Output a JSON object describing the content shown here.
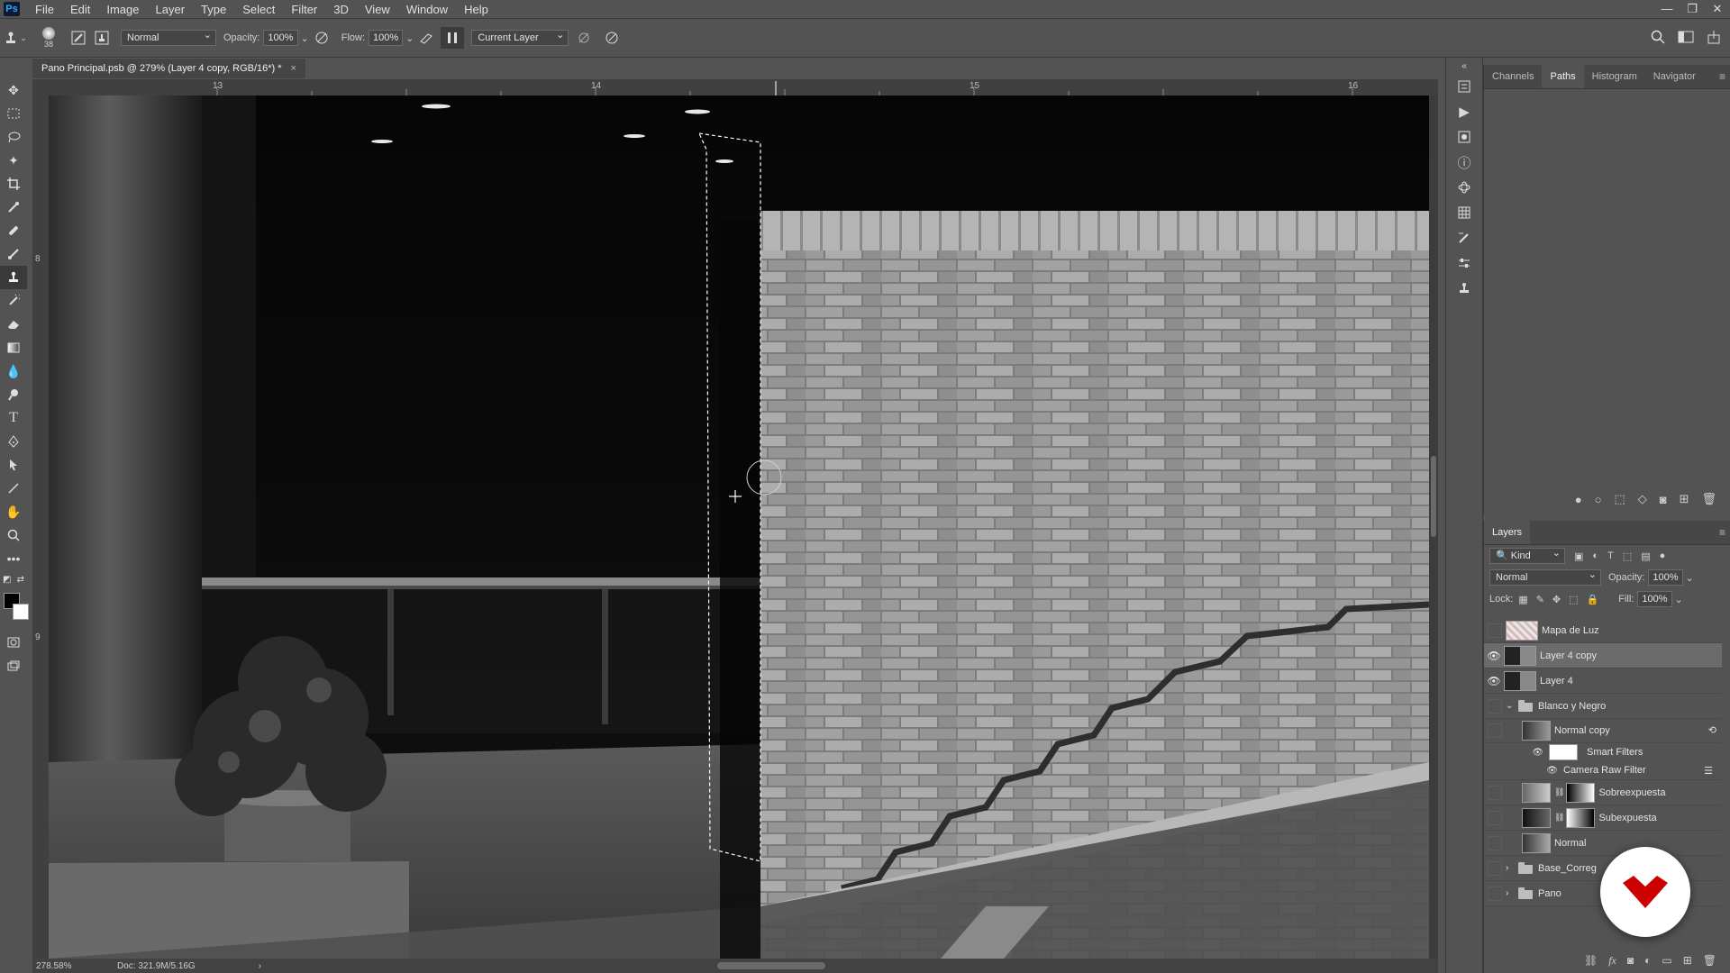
{
  "menu": [
    "File",
    "Edit",
    "Image",
    "Layer",
    "Type",
    "Select",
    "Filter",
    "3D",
    "View",
    "Window",
    "Help"
  ],
  "app_logo": "Ps",
  "window_controls": [
    "—",
    "❐",
    "✕"
  ],
  "options": {
    "brush_size": "38",
    "mode": "Normal",
    "opacity_label": "Opacity:",
    "opacity_value": "100%",
    "flow_label": "Flow:",
    "flow_value": "100%",
    "sample": "Current Layer"
  },
  "document": {
    "tab_title": "Pano Principal.psb @ 279% (Layer 4 copy, RGB/16*) *",
    "close": "×"
  },
  "ruler_top": [
    "13",
    "14",
    "15",
    "16"
  ],
  "ruler_left": [
    "8",
    "9"
  ],
  "status": {
    "zoom": "278.58%",
    "doc": "Doc: 321.9M/5.16G",
    "arrow": "›"
  },
  "top_panel": {
    "tabs": [
      "Channels",
      "Paths",
      "Histogram",
      "Navigator"
    ],
    "active": "Paths",
    "menu_icon": "≡"
  },
  "layers_panel": {
    "title": "Layers",
    "filter_kind": "Kind",
    "blend": "Normal",
    "opacity_label": "Opacity:",
    "opacity": "100%",
    "lock_label": "Lock:",
    "fill_label": "Fill:",
    "fill": "100%",
    "layers": [
      {
        "name": "Mapa de Luz",
        "visible": false
      },
      {
        "name": "Layer 4 copy",
        "visible": true,
        "selected": true
      },
      {
        "name": "Layer 4",
        "visible": true
      },
      {
        "name": "Blanco y Negro",
        "group": true,
        "expanded": true
      },
      {
        "name": "Normal copy"
      },
      {
        "name": "Smart Filters"
      },
      {
        "name": "Camera Raw Filter"
      },
      {
        "name": "Sobreexpuesta"
      },
      {
        "name": "Subexpuesta"
      },
      {
        "name": "Normal"
      },
      {
        "name": "Base_Correg"
      },
      {
        "name": "Pano"
      }
    ]
  },
  "colors": {
    "accent": "#31a8ff",
    "badge": "#cc0000"
  }
}
